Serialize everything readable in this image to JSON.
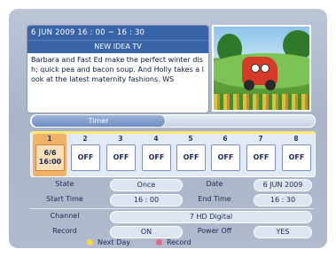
{
  "info": {
    "time": "6 JUN 2009  16 : 00 ~ 16 : 30",
    "title": "NEW IDEA TV",
    "description": "Barbara and Fast Ed make the perfect winter dish; quick pea and bacon soup. And Holly takes a look at the latest maternity fashions. WS"
  },
  "preview": {
    "description": "program preview thumbnail"
  },
  "section": {
    "label": "Timer"
  },
  "timers": [
    {
      "number": "1",
      "value": "6/6\n16:00",
      "selected": true
    },
    {
      "number": "2",
      "value": "OFF",
      "selected": false
    },
    {
      "number": "3",
      "value": "OFF",
      "selected": false
    },
    {
      "number": "4",
      "value": "OFF",
      "selected": false
    },
    {
      "number": "5",
      "value": "OFF",
      "selected": false
    },
    {
      "number": "6",
      "value": "OFF",
      "selected": false
    },
    {
      "number": "7",
      "value": "OFF",
      "selected": false
    },
    {
      "number": "8",
      "value": "OFF",
      "selected": false
    }
  ],
  "settings": {
    "state_label": "State",
    "state_value": "Once",
    "date_label": "Date",
    "date_value": "6 JUN 2009",
    "start_label": "Start Time",
    "start_value": "16 : 00",
    "end_label": "End Time",
    "end_value": "16 : 30",
    "channel_label": "Channel",
    "channel_value": "7 HD Digital",
    "record_label": "Record",
    "record_value": "ON",
    "power_label": "Power Off",
    "power_value": "YES"
  },
  "footer": {
    "yellow_label": "Next Day",
    "yellow_color": "#f2d84a",
    "red_label": "Record",
    "red_color": "#e06a8a"
  }
}
